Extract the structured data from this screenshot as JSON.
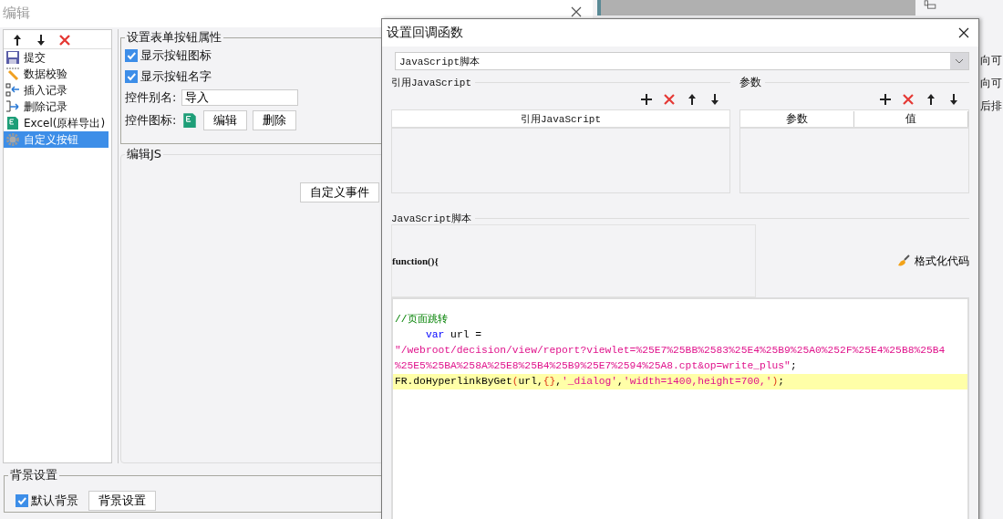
{
  "back_window": {
    "title": "编辑",
    "button_list": [
      {
        "label": "提交",
        "kind": "submit",
        "selected": false
      },
      {
        "label": "数据校验",
        "kind": "validate",
        "selected": false
      },
      {
        "label": "插入记录",
        "kind": "insert",
        "selected": false
      },
      {
        "label": "删除记录",
        "kind": "remove",
        "selected": false
      },
      {
        "label": "Excel(原样导出)",
        "kind": "excel",
        "selected": false
      },
      {
        "label": "自定义按钮",
        "kind": "custom",
        "selected": true
      }
    ],
    "properties": {
      "title": "设置表单按钮属性",
      "checkboxes": [
        {
          "label": "显示按钮图标",
          "checked": true
        },
        {
          "label": "显示按钮名字",
          "checked": true
        }
      ],
      "alias_label": "控件别名:",
      "alias_value": "导入",
      "icon_label": "控件图标:",
      "buttons": [
        "编辑",
        "删除"
      ]
    },
    "edit_js": {
      "title": "编辑JS",
      "button": "自定义事件"
    },
    "background": {
      "title": "背景设置",
      "checkbox": {
        "label": "默认背景",
        "checked": true
      },
      "button": "背景设置"
    }
  },
  "background_app": {
    "side_texts": [
      "向可",
      "向可",
      "后排"
    ]
  },
  "dialog": {
    "title": "设置回调函数",
    "type_select": "JavaScript脚本",
    "imports": {
      "title": "引用JavaScript",
      "column": "引用JavaScript"
    },
    "params": {
      "title": "参数",
      "columns": [
        "参数",
        "值"
      ]
    },
    "script": {
      "title": "JavaScript脚本",
      "signature": "function(){",
      "format_button": "格式化代码",
      "lines": [
        {
          "indented": false,
          "highlighted": false,
          "tokens": [
            {
              "kind": "comment",
              "text": "//页面跳转"
            }
          ]
        },
        {
          "indented": true,
          "highlighted": false,
          "tokens": [
            {
              "kind": "keyword",
              "text": "var"
            },
            {
              "kind": "plain",
              "text": " url ="
            }
          ]
        },
        {
          "indented": false,
          "highlighted": false,
          "tokens": [
            {
              "kind": "string",
              "text": "\"/webroot/decision/view/report?viewlet=%25E7%25BB%2583%25E4%25B9%25A0%252F%25E4%25B8%25B4"
            }
          ]
        },
        {
          "indented": false,
          "highlighted": false,
          "tokens": [
            {
              "kind": "string",
              "text": "%25E5%25BA%258A%25E8%25B4%25B9%25E7%2594%25A8.cpt&op=write_plus\""
            },
            {
              "kind": "plain",
              "text": ";"
            }
          ]
        },
        {
          "indented": false,
          "highlighted": true,
          "tokens": [
            {
              "kind": "plain",
              "text": "FR.doHyperlinkByGet"
            },
            {
              "kind": "bracket",
              "text": "("
            },
            {
              "kind": "plain",
              "text": "url,"
            },
            {
              "kind": "bracket",
              "text": "{}"
            },
            {
              "kind": "plain",
              "text": ","
            },
            {
              "kind": "string",
              "text": "'_dialog'"
            },
            {
              "kind": "plain",
              "text": ","
            },
            {
              "kind": "string",
              "text": "'width=1400,height=700,'"
            },
            {
              "kind": "bracket",
              "text": ")"
            },
            {
              "kind": "plain",
              "text": ";"
            }
          ]
        }
      ]
    }
  }
}
